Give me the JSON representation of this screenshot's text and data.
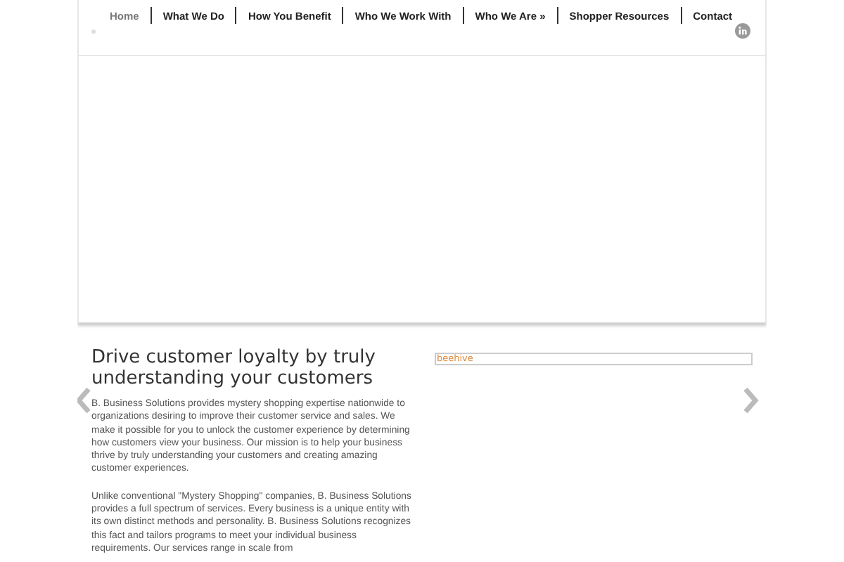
{
  "nav": [
    {
      "label": "Home",
      "selected": true
    },
    {
      "label": "What We Do",
      "selected": false
    },
    {
      "label": "How You Benefit",
      "selected": false
    },
    {
      "label": "Who We Work With",
      "selected": false
    },
    {
      "label": "Who We Are »",
      "selected": false
    },
    {
      "label": "Shopper Resources",
      "selected": false
    },
    {
      "label": "Contact",
      "selected": false
    }
  ],
  "heading": "Drive customer loyalty by truly understanding your customers",
  "paragraphs": [
    "B. Business Solutions provides mystery shopping expertise nationwide to organizations desiring to improve their customer service and sales. We make it possible for you to unlock the customer experience by determining how customers view your business. Our mission is to help your business thrive by truly understanding your customers and creating amazing customer experiences.",
    "Unlike conventional \"Mystery Shopping\" companies, B. Business Solutions provides a full spectrum of services. Every business is a unique entity with its own distinct methods and personality. B. Business Solutions recognizes this fact and tailors programs to meet your individual business requirements. Our services range in scale from"
  ],
  "image_alt": "beehive"
}
